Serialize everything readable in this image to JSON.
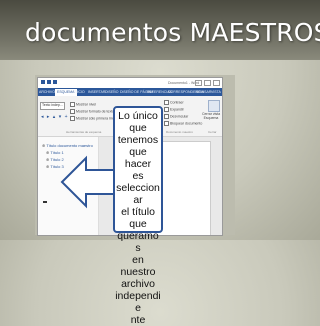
{
  "slide": {
    "title": "documentos MAESTROS"
  },
  "callout": {
    "lines": [
      "Lo único",
      "que",
      "tenemos",
      "que hacer",
      "es",
      "seleccionar",
      "el título",
      "que",
      "queramos",
      "en nuestro",
      "archivo",
      "independie",
      "nte"
    ]
  },
  "word_window": {
    "document_title": "Documento1 - Word",
    "tabs": [
      "ARCHIVO",
      "ESQUEMA",
      "INICIO",
      "INSERTAR",
      "DISEÑO",
      "DISEÑO DE PÁGINA",
      "REFERENCIAS",
      "CORRESPONDENCIA",
      "REVISAR",
      "VISTA"
    ],
    "style_select": "Texto indep...",
    "ribbon_options": [
      "Mostrar nivel",
      "Mostrar formato de texto",
      "Mostrar sólo primera línea"
    ],
    "master_options": [
      "Contraer",
      "Expandir",
      "Desvincular",
      "Bloquear documento"
    ],
    "close_button": "Cerrar vista Esquema",
    "group_labels": [
      "Herramientas de esquema",
      "Documento maestro",
      "Cerrar"
    ],
    "nav_items": [
      "Título documento maestro",
      "Título 1",
      "Título 2",
      "Título 3"
    ]
  },
  "colors": {
    "ribbon_blue": "#2b579a",
    "callout_border": "#2e5597",
    "title_band": "#4a4a40"
  }
}
